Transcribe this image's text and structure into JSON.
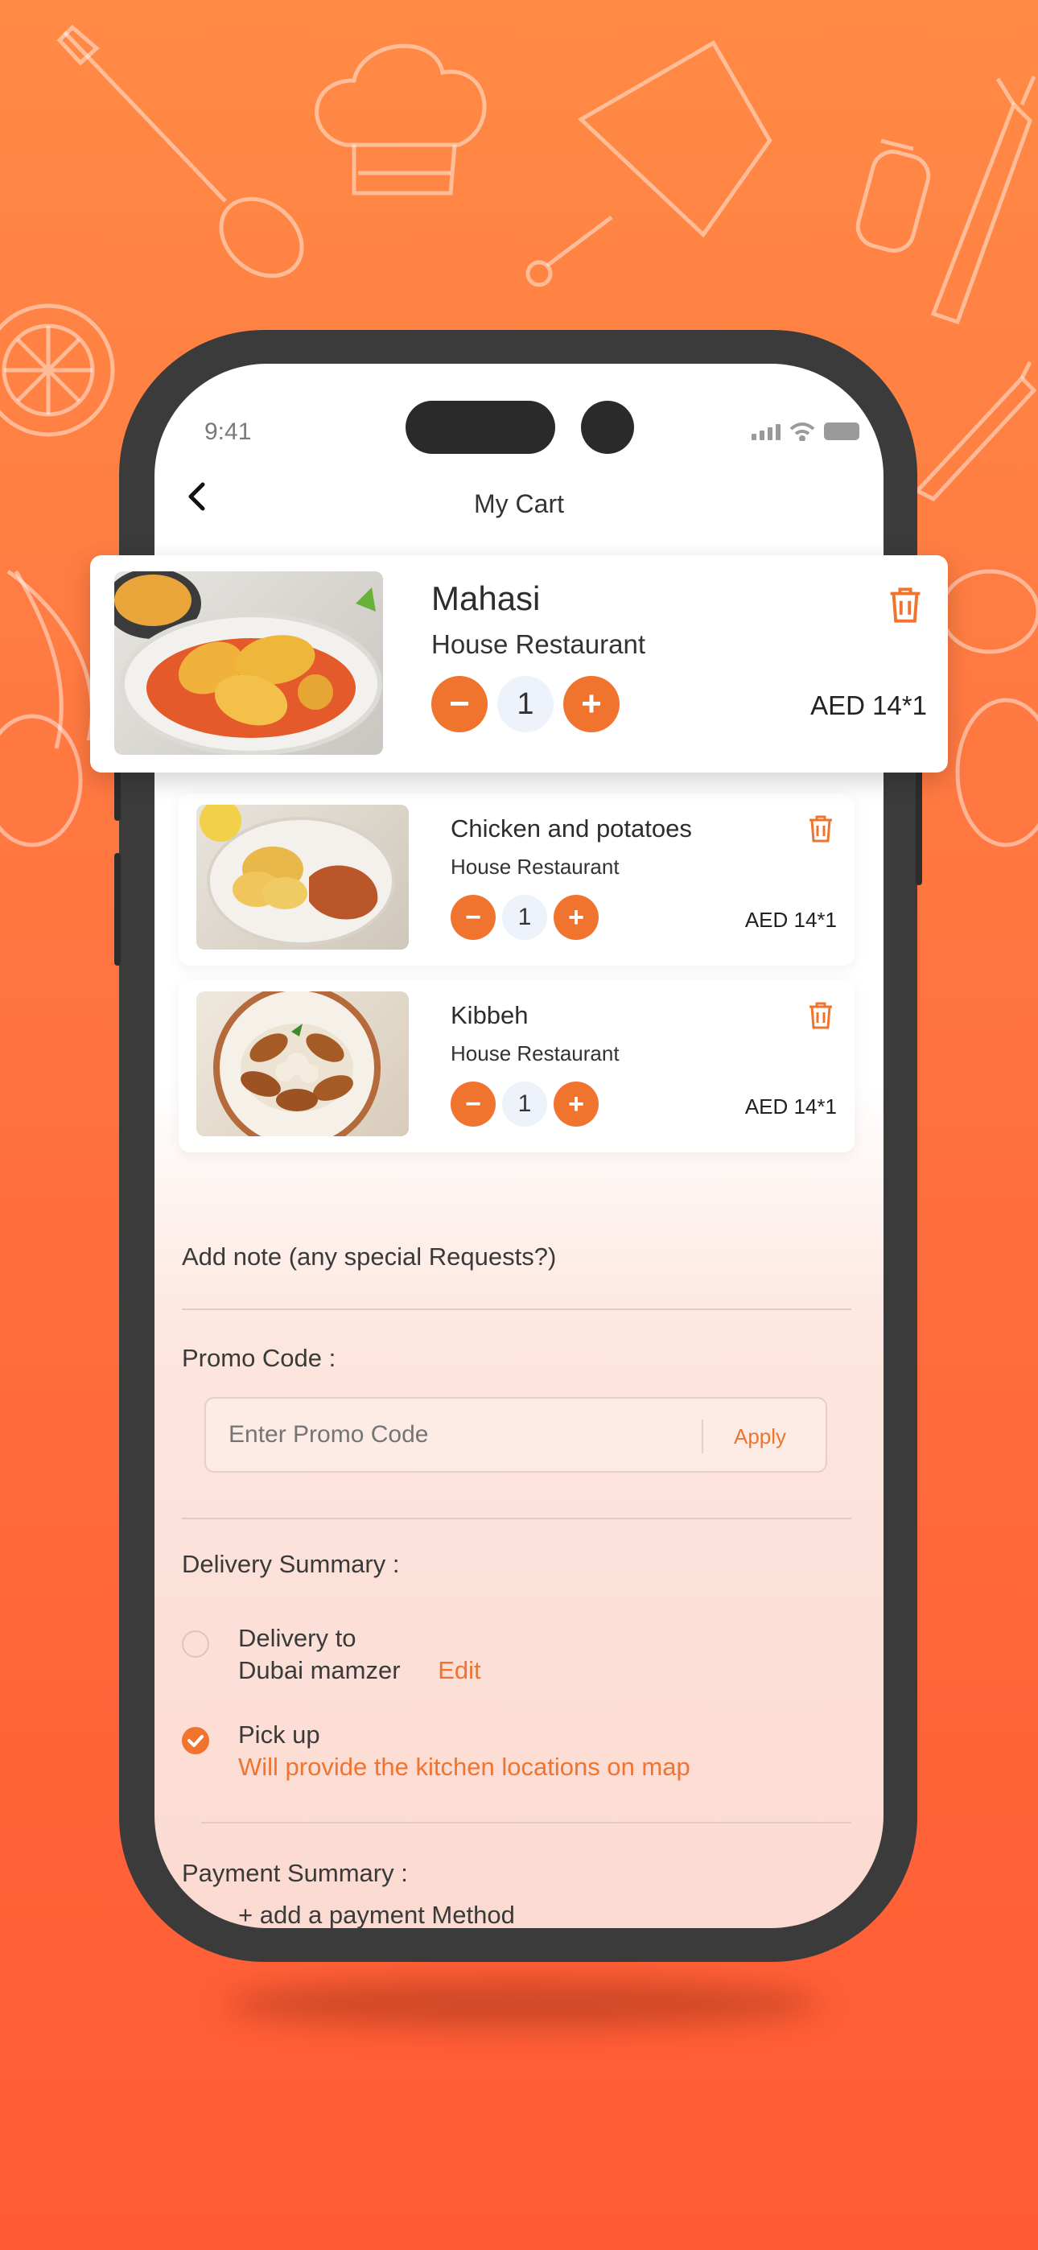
{
  "status_bar": {
    "time": "9:41"
  },
  "header": {
    "title": "My Cart"
  },
  "cart_items": [
    {
      "name": "Mahasi",
      "restaurant": "House Restaurant",
      "quantity": "1",
      "price": "AED 14*1"
    },
    {
      "name": "Chicken  and potatoes",
      "restaurant": "House Restaurant",
      "quantity": "1",
      "price": "AED 14*1"
    },
    {
      "name": "Kibbeh",
      "restaurant": "House Restaurant",
      "quantity": "1",
      "price": "AED 14*1"
    }
  ],
  "note": {
    "label": "Add note (any special Requests?)"
  },
  "promo": {
    "label": "Promo Code :",
    "placeholder": "Enter Promo Code",
    "apply_label": "Apply"
  },
  "delivery": {
    "label": "Delivery Summary :",
    "option_delivery_line1": "Delivery to",
    "option_delivery_line2": "Dubai mamzer",
    "edit_label": "Edit",
    "option_pickup": "Pick up",
    "pickup_note": "Will provide the kitchen locations on map",
    "selected": "pickup"
  },
  "payment": {
    "label": "Payment Summary :",
    "add_method": "+ add a payment Method"
  },
  "colors": {
    "accent": "#f0742e",
    "background_top": "#ff8a45",
    "background_bottom": "#ff5a34"
  }
}
